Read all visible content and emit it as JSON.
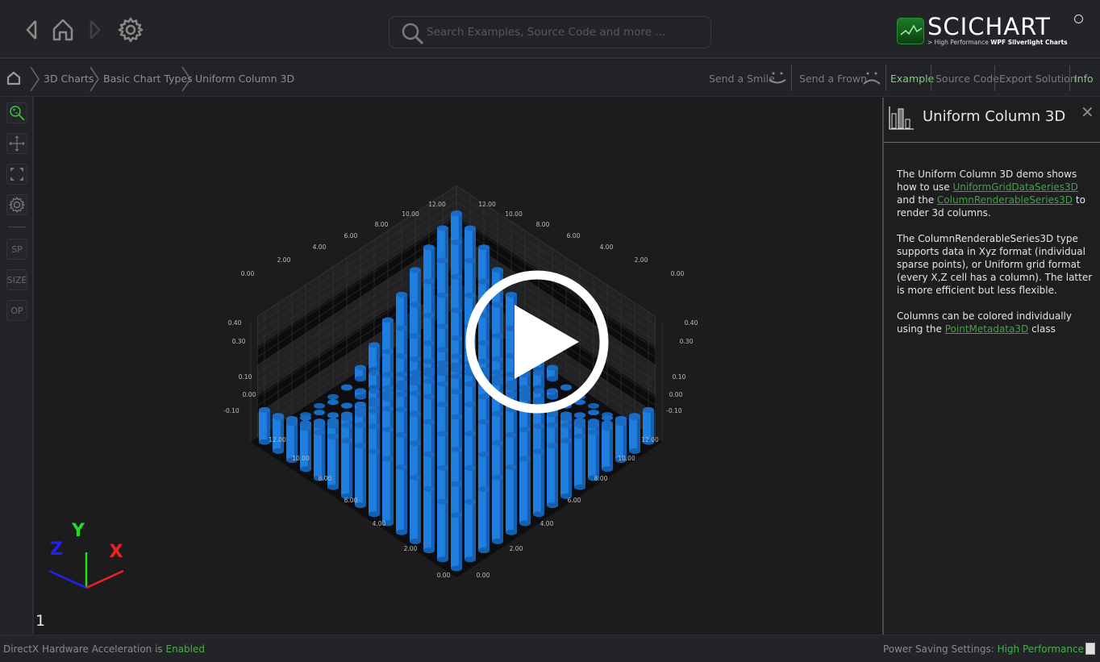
{
  "header": {
    "search_placeholder": "Search Examples, Source Code and more ...",
    "logo_title": "SCICHART",
    "logo_sub_prefix": "> High Performance ",
    "logo_sub_bold": "WPF Silverlight Charts"
  },
  "breadcrumb": {
    "items": [
      "3D Charts",
      "Basic Chart Types",
      "Uniform Column 3D"
    ]
  },
  "tabs": {
    "send_smile": "Send a Smile",
    "send_frown": "Send a Frown",
    "example": "Example",
    "source_code": "Source Code",
    "export_solution": "Export Solution",
    "info": "Info"
  },
  "toolbar": {
    "sp": "SP",
    "size": "SIZE",
    "op": "OP"
  },
  "chart_data": {
    "type": "3d-column",
    "title": "Uniform Column 3D",
    "x_ticks": [
      "0.00",
      "2.00",
      "4.00",
      "6.00",
      "8.00",
      "10.00",
      "12.00"
    ],
    "z_ticks": [
      "0.00",
      "2.00",
      "4.00",
      "6.00",
      "8.00",
      "10.00",
      "12.00"
    ],
    "y_ticks": [
      "-0.10",
      "0.00",
      "0.10",
      "0.30",
      "0.40"
    ],
    "grid_size": [
      15,
      15
    ],
    "column_color": "#1f7fe0",
    "axis_gizmo": {
      "x": "X",
      "y": "Y",
      "z": "Z"
    },
    "grid": true
  },
  "page_number": "1",
  "info": {
    "title": "Uniform Column 3D",
    "p1_a": "The Uniform Column 3D demo shows how to use ",
    "p1_link1": "UniformGridDataSeries3D",
    "p1_b": " and the ",
    "p1_link2": "ColumnRenderableSeries3D",
    "p1_c": " to render 3d columns.",
    "p2": "The ColumnRenderableSeries3D type supports data in Xyz format (individual sparse points), or Uniform grid format (every X,Z cell has a column). The latter is more efficient but less flexible.",
    "p3_a": "Columns can be colored individually using the ",
    "p3_link": "PointMetadata3D",
    "p3_b": " class"
  },
  "status": {
    "left_label": "DirectX Hardware Acceleration is ",
    "left_value": "Enabled",
    "right_label": "Power Saving Settings: ",
    "right_value": "High Performance"
  }
}
